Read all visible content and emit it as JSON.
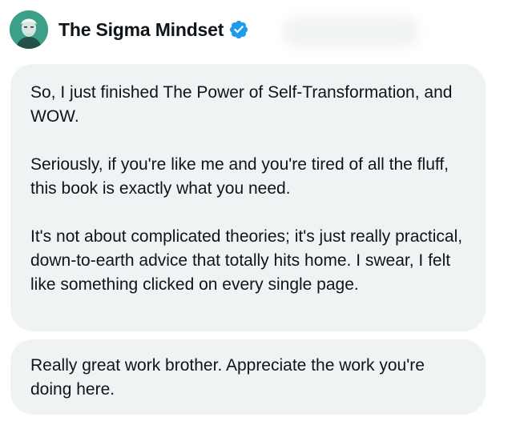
{
  "author": {
    "name": "The Sigma Mindset",
    "avatar_icon": "profile-avatar",
    "verified_icon": "verified-badge-icon",
    "verified_color": "#1d9bf0"
  },
  "messages": [
    {
      "paragraphs": [
        "So, I just finished The Power of Self-Transformation, and WOW.",
        "Seriously, if you're like me and you're tired of all the fluff, this book is exactly what you need.",
        "It's not about complicated theories; it's just really practical, down-to-earth advice that totally hits home. I swear, I felt like something clicked on every single page."
      ]
    },
    {
      "paragraphs": [
        "Really great work brother. Appreciate the work you're doing here."
      ]
    }
  ],
  "colors": {
    "bubble_background": "#eff3f4",
    "text": "#0f1419"
  }
}
